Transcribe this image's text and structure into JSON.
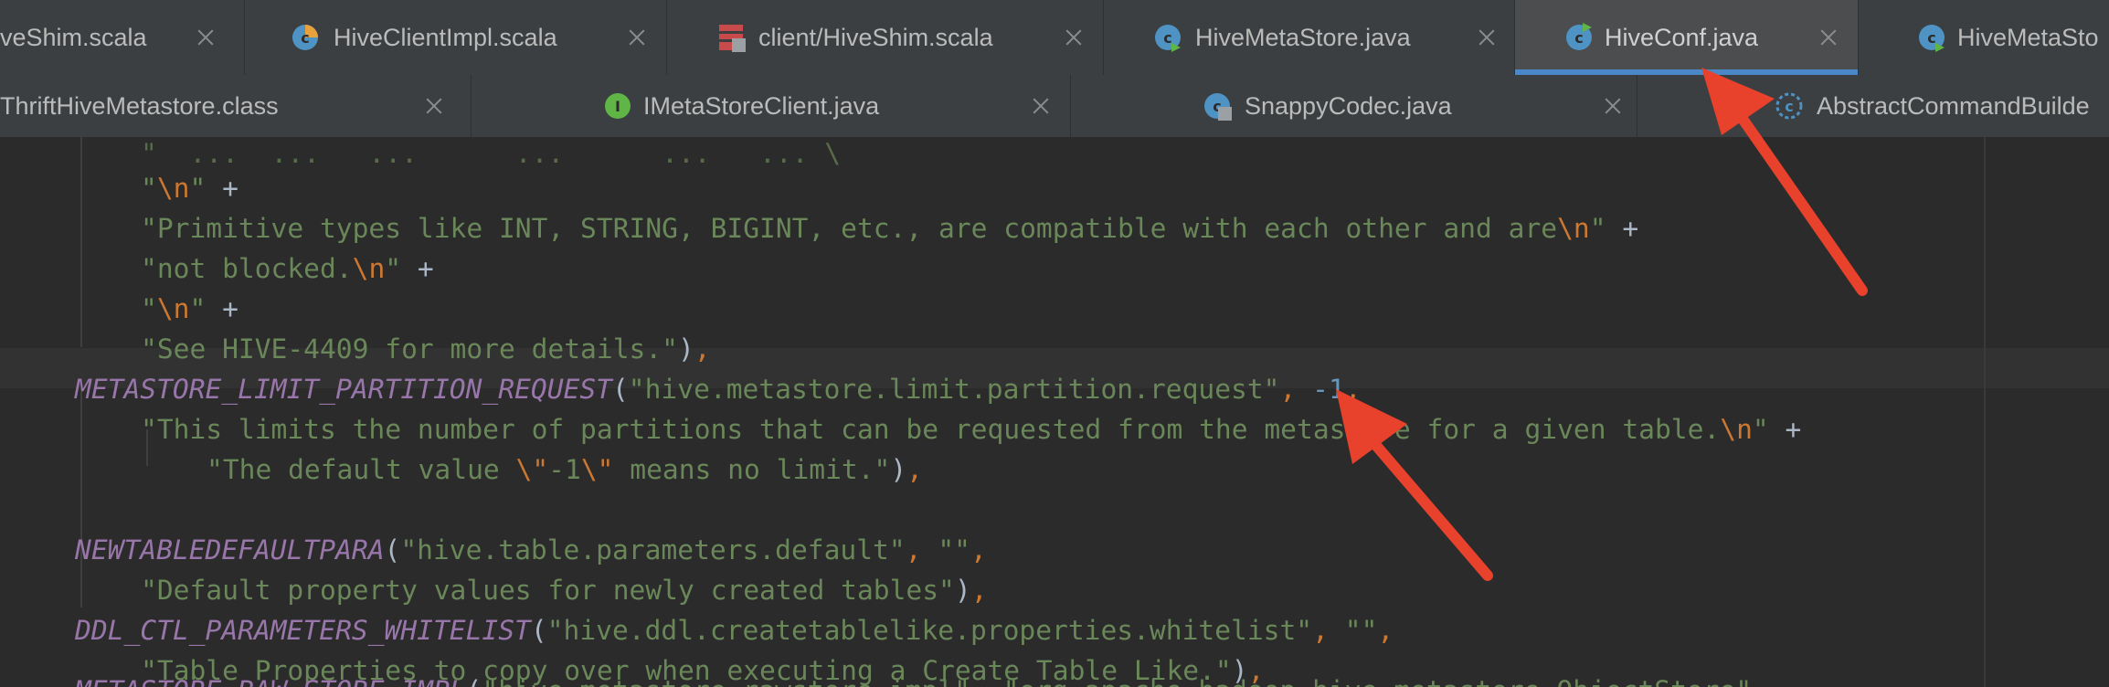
{
  "tabs_row1": [
    {
      "label": "veShim.scala",
      "icon": "scala-icon"
    },
    {
      "label": "HiveClientImpl.scala",
      "icon": "scala-class-icon"
    },
    {
      "label": "client/HiveShim.scala",
      "icon": "scala-object-icon"
    },
    {
      "label": "HiveMetaStore.java",
      "icon": "java-class-icon"
    },
    {
      "label": "HiveConf.java",
      "icon": "java-class-icon",
      "active": true
    },
    {
      "label": "HiveMetaSto",
      "icon": "java-class-icon"
    }
  ],
  "tabs_row2": [
    {
      "label": "ThriftHiveMetastore.class",
      "icon": "none"
    },
    {
      "label": "IMetaStoreClient.java",
      "icon": "java-interface-icon"
    },
    {
      "label": "SnappyCodec.java",
      "icon": "java-class-icon"
    },
    {
      "label": "AbstractCommandBuilde",
      "icon": "abstract-class-icon"
    }
  ],
  "code": {
    "l1": {
      "s1": "\"",
      "e1": "\\n",
      "s2": "\"",
      "op": " +"
    },
    "l2": {
      "s1": "\"Primitive types like INT, STRING, BIGINT, etc., are compatible with each other and are",
      "e1": "\\n",
      "s2": "\"",
      "op": " +"
    },
    "l3": {
      "s1": "\"not blocked.",
      "e1": "\\n",
      "s2": "\"",
      "op": " +"
    },
    "l4": {
      "s1": "\"",
      "e1": "\\n",
      "s2": "\"",
      "op": " +"
    },
    "l5": {
      "s1": "\"See HIVE-4409 for more details.\"",
      "op": ")",
      "k": ","
    },
    "l6": {
      "enum": "METASTORE_LIMIT_PARTITION_REQUEST",
      "p": "(",
      "s1": "\"hive.metastore.limit.partition.request\"",
      "k1": ",",
      "num": " -1",
      "k2": ","
    },
    "l7": {
      "s1": "\"This limits the number of partitions that can be requested from the metastore for a given table.",
      "e1": "\\n",
      "s2": "\"",
      "op": " +"
    },
    "l8": {
      "s1": "\"The default value ",
      "e1": "\\\"",
      "s2": "-1",
      "e2": "\\\"",
      "s3": " means no limit.\"",
      "op": ")",
      "k": ","
    },
    "l9": {
      "enum": "NEWTABLEDEFAULTPARA",
      "p": "(",
      "s1": "\"hive.table.parameters.default\"",
      "k1": ",",
      "s2": " \"\"",
      "k2": ","
    },
    "l10": {
      "s1": "\"Default property values for newly created tables\"",
      "op": ")",
      "k": ","
    },
    "l11": {
      "enum": "DDL_CTL_PARAMETERS_WHITELIST",
      "p": "(",
      "s1": "\"hive.ddl.createtablelike.properties.whitelist\"",
      "k1": ",",
      "s2": " \"\"",
      "k2": ","
    },
    "l12": {
      "s1": "\"Table Properties to copy over when executing a Create Table Like.\"",
      "op": ")",
      "k": ","
    },
    "l13": {
      "enum": "METASTORE_RAW_STORE_IMPL",
      "p": "(",
      "s1": "\"hive.metastore.rawstore.impl\"",
      "k1": ",",
      "s2": " \"org.apache.hadoop.hive.metastore.ObjectStore\""
    }
  },
  "colors": {
    "arrow": "#e8412c",
    "active_tab_underline": "#4a88c7"
  }
}
